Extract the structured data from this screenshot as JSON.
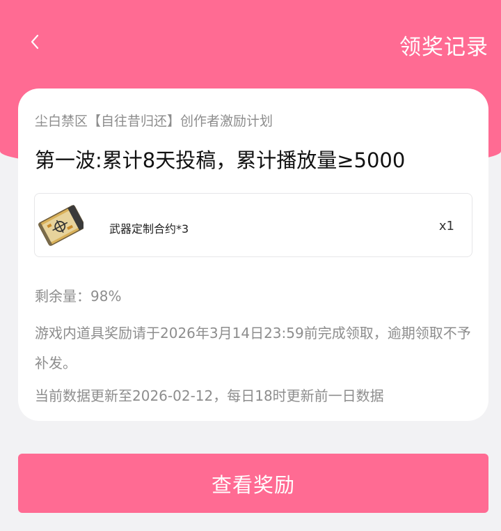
{
  "header": {
    "back_icon": "chevron-left-icon",
    "records_label": "领奖记录"
  },
  "card": {
    "campaign_name": "尘白禁区【自往昔归还】创作者激励计划",
    "stage_title": "第一波:累计8天投稿，累计播放量≥5000",
    "reward": {
      "icon": "weapon-contract-icon",
      "name": "武器定制合约*3",
      "quantity": "x1"
    },
    "remaining": "剩余量：98%",
    "deadline_note": "游戏内道具奖励请于2026年3月14日23:59前完成领取，逾期领取不予补发。",
    "update_note": "当前数据更新至2026-02-12，每日18时更新前一日数据"
  },
  "action": {
    "view_rewards_label": "查看奖励"
  },
  "colors": {
    "accent": "#ff6b93",
    "background": "#f2f2f4",
    "card": "#ffffff",
    "muted_text": "#8d8d8d"
  }
}
